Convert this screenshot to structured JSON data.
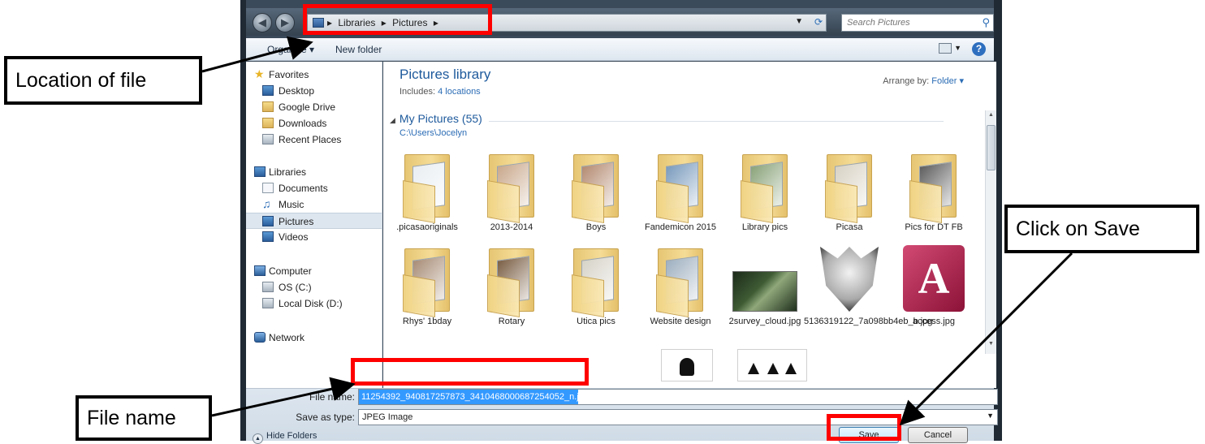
{
  "window": {
    "breadcrumb": [
      "Libraries",
      "Pictures"
    ],
    "search_placeholder": "Search Pictures"
  },
  "toolbar": {
    "organize_label": "Organize",
    "new_folder_label": "New folder"
  },
  "sidebar": {
    "favorites": {
      "label": "Favorites",
      "items": [
        "Desktop",
        "Google Drive",
        "Downloads",
        "Recent Places"
      ]
    },
    "libraries": {
      "label": "Libraries",
      "items": [
        "Documents",
        "Music",
        "Pictures",
        "Videos"
      ],
      "selected": "Pictures"
    },
    "computer": {
      "label": "Computer",
      "items": [
        "OS (C:)",
        "Local Disk (D:)"
      ]
    },
    "network": {
      "label": "Network"
    }
  },
  "content": {
    "library_title": "Pictures library",
    "includes_label": "Includes:",
    "includes_link": "4 locations",
    "arrange_label": "Arrange by:",
    "arrange_value": "Folder",
    "group_title": "My Pictures (55)",
    "group_path": "C:\\Users\\Jocelyn",
    "items": [
      ".picasaoriginals",
      "2013-2014",
      "Boys",
      "Fandemicon 2015",
      "Library pics",
      "Picasa",
      "Pics for DT FB",
      "Rhys' 1bday",
      "Rotary",
      "Utica pics",
      "Website design",
      "2survey_cloud.jpg",
      "5136319122_7a098bb4eb_b.jpg",
      "access.jpg"
    ]
  },
  "bottom": {
    "file_name_label": "File name:",
    "file_name_value": "11254392_940817257873_3410468000687254052_n.jpg",
    "save_as_type_label": "Save as type:",
    "save_as_type_value": "JPEG Image",
    "hide_folders_label": "Hide Folders",
    "save_label": "Save",
    "cancel_label": "Cancel"
  },
  "annotations": {
    "location": "Location of file",
    "file_name": "File name",
    "save": "Click on Save"
  },
  "colors": {
    "highlight": "#ff0000",
    "selection": "#3399ff",
    "library_title": "#1e5a9c"
  }
}
